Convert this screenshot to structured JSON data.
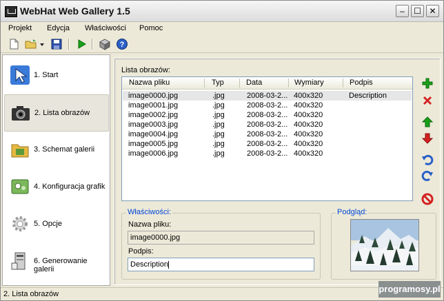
{
  "window": {
    "title": "WebHat Web Gallery 1.5"
  },
  "menu": [
    "Projekt",
    "Edycja",
    "Właściwości",
    "Pomoc"
  ],
  "toolbar": {
    "icons": [
      "new-file-icon",
      "open-folder-icon",
      "save-icon",
      "run-icon",
      "box-icon",
      "help-icon"
    ]
  },
  "nav": {
    "items": [
      {
        "label": "1. Start",
        "icon": "cursor-icon"
      },
      {
        "label": "2. Lista obrazów",
        "icon": "camera-icon"
      },
      {
        "label": "3. Schemat galerii",
        "icon": "folder-icon"
      },
      {
        "label": "4. Konfiguracja grafik",
        "icon": "image-config-icon"
      },
      {
        "label": "5. Opcje",
        "icon": "gear-icon"
      },
      {
        "label": "6. Generowanie galerii",
        "icon": "computer-icon"
      }
    ],
    "selected": 1
  },
  "list": {
    "label": "Lista obrazów:",
    "columns": [
      "Nazwa pliku",
      "Typ",
      "Data",
      "Wymiary",
      "Podpis"
    ],
    "rows": [
      [
        "image0000.jpg",
        ".jpg",
        "2008-03-2...",
        "400x320",
        "Description"
      ],
      [
        "image0001.jpg",
        ".jpg",
        "2008-03-2...",
        "400x320",
        ""
      ],
      [
        "image0002.jpg",
        ".jpg",
        "2008-03-2...",
        "400x320",
        ""
      ],
      [
        "image0003.jpg",
        ".jpg",
        "2008-03-2...",
        "400x320",
        ""
      ],
      [
        "image0004.jpg",
        ".jpg",
        "2008-03-2...",
        "400x320",
        ""
      ],
      [
        "image0005.jpg",
        ".jpg",
        "2008-03-2...",
        "400x320",
        ""
      ],
      [
        "image0006.jpg",
        ".jpg",
        "2008-03-2...",
        "400x320",
        ""
      ]
    ]
  },
  "side_buttons": [
    "add-icon",
    "remove-icon",
    "move-up-icon",
    "move-down-icon",
    "rotate-left-icon",
    "rotate-right-icon",
    "clear-icon"
  ],
  "properties": {
    "title": "Właściwości:",
    "filename_label": "Nazwa pliku:",
    "filename_value": "image0000.jpg",
    "caption_label": "Podpis:",
    "caption_value": "Description"
  },
  "preview": {
    "title": "Podgląd:"
  },
  "status": {
    "text": "2. Lista obrazów"
  },
  "watermark": "programosy.pl",
  "colors": {
    "accent": "#0046d5",
    "add": "#1aa01a",
    "remove": "#d42020"
  }
}
